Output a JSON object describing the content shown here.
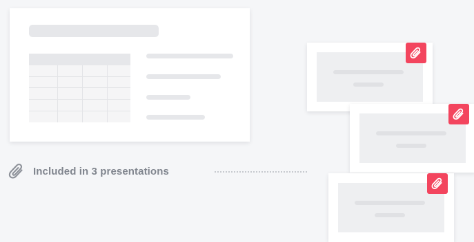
{
  "included": {
    "text": "Included in 3 presentations"
  },
  "icons": {
    "included_icon": "paperclip-icon",
    "slide_badge_icon": "paperclip-icon"
  },
  "colors": {
    "background": "#f5f6f8",
    "card": "#ffffff",
    "placeholder": "#e6e7ea",
    "badge": "#f3455e",
    "text_muted": "#80858e"
  },
  "presentations_count": 3
}
